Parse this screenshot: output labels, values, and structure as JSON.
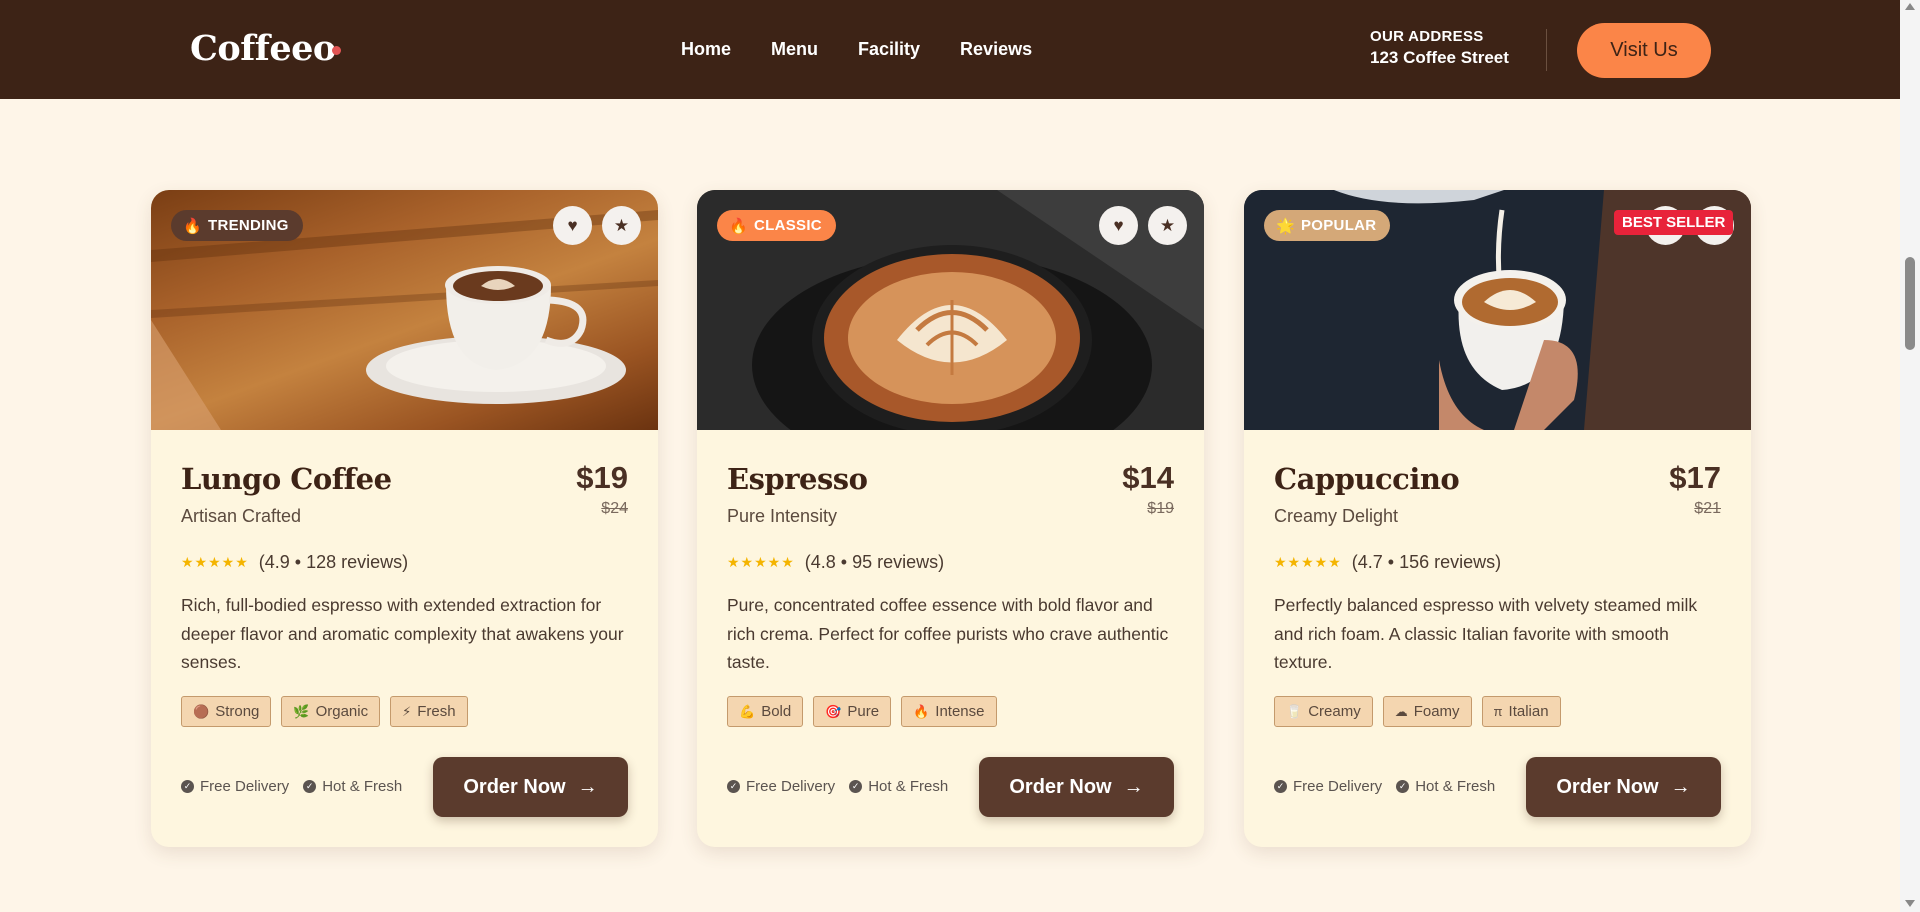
{
  "brand": {
    "name": "Coffeeo"
  },
  "nav": {
    "items": [
      "Home",
      "Menu",
      "Facility",
      "Reviews"
    ]
  },
  "address": {
    "label": "OUR ADDRESS",
    "value": "123 Coffee Street"
  },
  "header": {
    "cta": "Visit Us"
  },
  "cards": [
    {
      "badge": "TRENDING",
      "badge_icon": "🔥",
      "badge_color": "#5b3b2d",
      "title": "Lungo Coffee",
      "subtitle": "Artisan Crafted",
      "price": "$19",
      "old_price": "$24",
      "stars": "★★★★★",
      "rating_text": "(4.9 • 128 reviews)",
      "description": "Rich, full-bodied espresso with extended extraction for deeper flavor and aromatic complexity that awakens your senses.",
      "tags": [
        {
          "icon": "🟤",
          "label": "Strong"
        },
        {
          "icon": "🌿",
          "label": "Organic"
        },
        {
          "icon": "⚡",
          "label": "Fresh"
        }
      ],
      "features": [
        "Free Delivery",
        "Hot & Fresh"
      ],
      "cta": "Order Now"
    },
    {
      "badge": "CLASSIC",
      "badge_icon": "🔥",
      "badge_color": "#fb8548",
      "title": "Espresso",
      "subtitle": "Pure Intensity",
      "price": "$14",
      "old_price": "$19",
      "stars": "★★★★★",
      "rating_text": "(4.8 • 95 reviews)",
      "description": "Pure, concentrated coffee essence with bold flavor and rich crema. Perfect for coffee purists who crave authentic taste.",
      "tags": [
        {
          "icon": "💪",
          "label": "Bold"
        },
        {
          "icon": "🎯",
          "label": "Pure"
        },
        {
          "icon": "🔥",
          "label": "Intense"
        }
      ],
      "features": [
        "Free Delivery",
        "Hot & Fresh"
      ],
      "cta": "Order Now"
    },
    {
      "badge": "POPULAR",
      "badge_icon": "🌟",
      "badge_color": "#d4a878",
      "best_seller": "BEST SELLER",
      "title": "Cappuccino",
      "subtitle": "Creamy Delight",
      "price": "$17",
      "old_price": "$21",
      "stars": "★★★★★",
      "rating_text": "(4.7 • 156 reviews)",
      "description": "Perfectly balanced espresso with velvety steamed milk and rich foam. A classic Italian favorite with smooth texture.",
      "tags": [
        {
          "icon": "🥛",
          "label": "Creamy"
        },
        {
          "icon": "☁",
          "label": "Foamy"
        },
        {
          "icon": "π",
          "label": "Italian"
        }
      ],
      "features": [
        "Free Delivery",
        "Hot & Fresh"
      ],
      "cta": "Order Now"
    }
  ]
}
